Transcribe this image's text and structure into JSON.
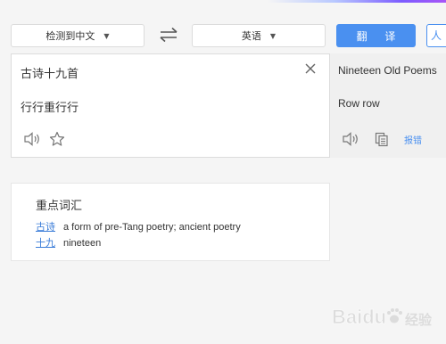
{
  "header": {
    "source_language": "检测到中文",
    "target_language": "英语",
    "translate_button": "翻 译",
    "extra_button": "人"
  },
  "source": {
    "lines": [
      "古诗十九首",
      "行行重行行"
    ]
  },
  "target": {
    "lines": [
      "Nineteen Old Poems",
      "Row row"
    ],
    "report_label": "报错"
  },
  "vocabulary": {
    "title": "重点词汇",
    "items": [
      {
        "term": "古诗",
        "definition": "a form of pre-Tang poetry; ancient poetry"
      },
      {
        "term": "十九",
        "definition": "nineteen"
      }
    ]
  },
  "watermark": {
    "brand": "Baidu",
    "suffix": "经验"
  },
  "icons": {
    "swap": "swap-arrows-icon",
    "clear": "close-icon",
    "speaker": "speaker-icon",
    "star": "star-icon",
    "copy": "copy-icon"
  },
  "colors": {
    "accent": "#4a90f0",
    "link": "#3b7dd8",
    "panel_bg": "#ffffff",
    "target_bg": "#f0f0f0",
    "page_bg": "#f5f5f5"
  }
}
